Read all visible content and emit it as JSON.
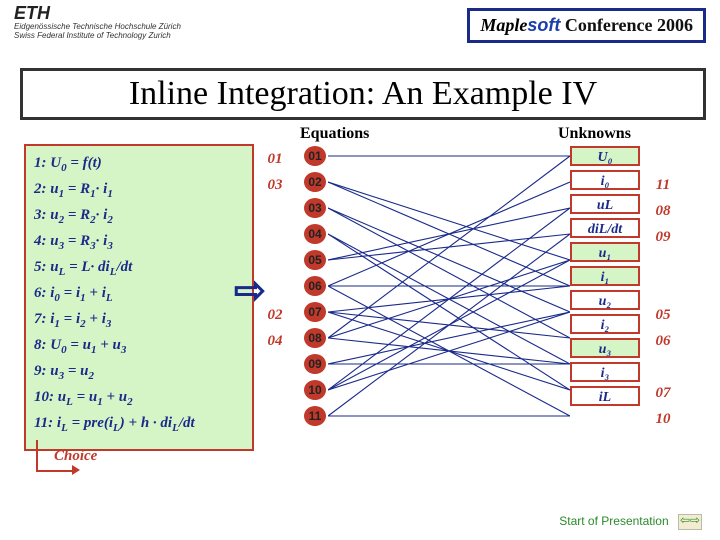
{
  "brand": {
    "name": "ETH",
    "sub": "Eidgenössische Technische Hochschule Zürich\nSwiss Federal Institute of Technology Zurich"
  },
  "conf": {
    "maple": "Maple",
    "soft": "soft",
    "rest": " Conference 2006"
  },
  "title": "Inline Integration: An Example IV",
  "labels": {
    "equations": "Equations",
    "unknowns": "Unknowns",
    "choice": "Choice",
    "startnav": "Start of Presentation"
  },
  "equations": [
    {
      "n": "1:",
      "body": "U",
      "sub": "0",
      "rest": " = f(t)"
    },
    {
      "n": "2:",
      "body": "u",
      "sub": "1",
      "rest": " = R",
      "sub2": "1",
      "rest2": "· i",
      "sub3": "1"
    },
    {
      "n": "3:",
      "body": "u",
      "sub": "2",
      "rest": " = R",
      "sub2": "2",
      "rest2": "· i",
      "sub3": "2"
    },
    {
      "n": "4:",
      "body": "u",
      "sub": "3",
      "rest": " = R",
      "sub2": "3",
      "rest2": "· i",
      "sub3": "3"
    },
    {
      "n": "5:",
      "body": "u",
      "sub": "L",
      "rest": " = L· di",
      "sub2": "L",
      "rest2": "/dt"
    },
    {
      "n": "6:",
      "body": "i",
      "sub": "0",
      "rest": " = i",
      "sub2": "1",
      "rest2": " + i",
      "sub3": "L"
    },
    {
      "n": "7:",
      "body": "i",
      "sub": "1",
      "rest": " = i",
      "sub2": "2",
      "rest2": " + i",
      "sub3": "3"
    },
    {
      "n": "8:",
      "body": "U",
      "sub": "0",
      "rest": " = u",
      "sub2": "1",
      "rest2": " + u",
      "sub3": "3"
    },
    {
      "n": "9:",
      "body": "u",
      "sub": "3",
      "rest": " = u",
      "sub2": "2"
    },
    {
      "n": "10:",
      "body": "u",
      "sub": "L",
      "rest": " = u",
      "sub2": "1",
      "rest2": " + u",
      "sub3": "2"
    },
    {
      "n": "11:",
      "body": "i",
      "sub": "L",
      "rest": " = pre(i",
      "sub2": "L",
      "rest2": ") + h · di",
      "sub3": "L",
      "rest3": "/dt"
    }
  ],
  "left_order": [
    "01",
    "03",
    "",
    "",
    "",
    "",
    "02",
    "04",
    "",
    "",
    ""
  ],
  "right_order": [
    "",
    "11",
    "08",
    "09",
    "",
    "",
    "05",
    "06",
    "",
    "07",
    "10"
  ],
  "eq_bubbles": [
    "01",
    "02",
    "03",
    "04",
    "05",
    "06",
    "07",
    "08",
    "09",
    "10",
    "11"
  ],
  "unknowns": [
    {
      "t": "U₀",
      "g": true
    },
    {
      "t": "i₀",
      "g": false
    },
    {
      "t": "uL",
      "g": false
    },
    {
      "t": "diL/dt",
      "g": false
    },
    {
      "t": "u₁",
      "g": true
    },
    {
      "t": "i₁",
      "g": true
    },
    {
      "t": "u₂",
      "g": false
    },
    {
      "t": "i₂",
      "g": false
    },
    {
      "t": "u₃",
      "g": true
    },
    {
      "t": "i₃",
      "g": false
    },
    {
      "t": "iL",
      "g": false
    }
  ],
  "bipartite": [
    [
      1,
      1
    ],
    [
      2,
      5
    ],
    [
      2,
      6
    ],
    [
      3,
      7
    ],
    [
      3,
      8
    ],
    [
      4,
      9
    ],
    [
      4,
      10
    ],
    [
      5,
      3
    ],
    [
      5,
      4
    ],
    [
      6,
      2
    ],
    [
      6,
      6
    ],
    [
      6,
      11
    ],
    [
      7,
      6
    ],
    [
      7,
      8
    ],
    [
      7,
      10
    ],
    [
      8,
      1
    ],
    [
      8,
      5
    ],
    [
      8,
      9
    ],
    [
      9,
      9
    ],
    [
      9,
      7
    ],
    [
      10,
      3
    ],
    [
      10,
      5
    ],
    [
      10,
      7
    ],
    [
      11,
      11
    ],
    [
      11,
      4
    ]
  ]
}
